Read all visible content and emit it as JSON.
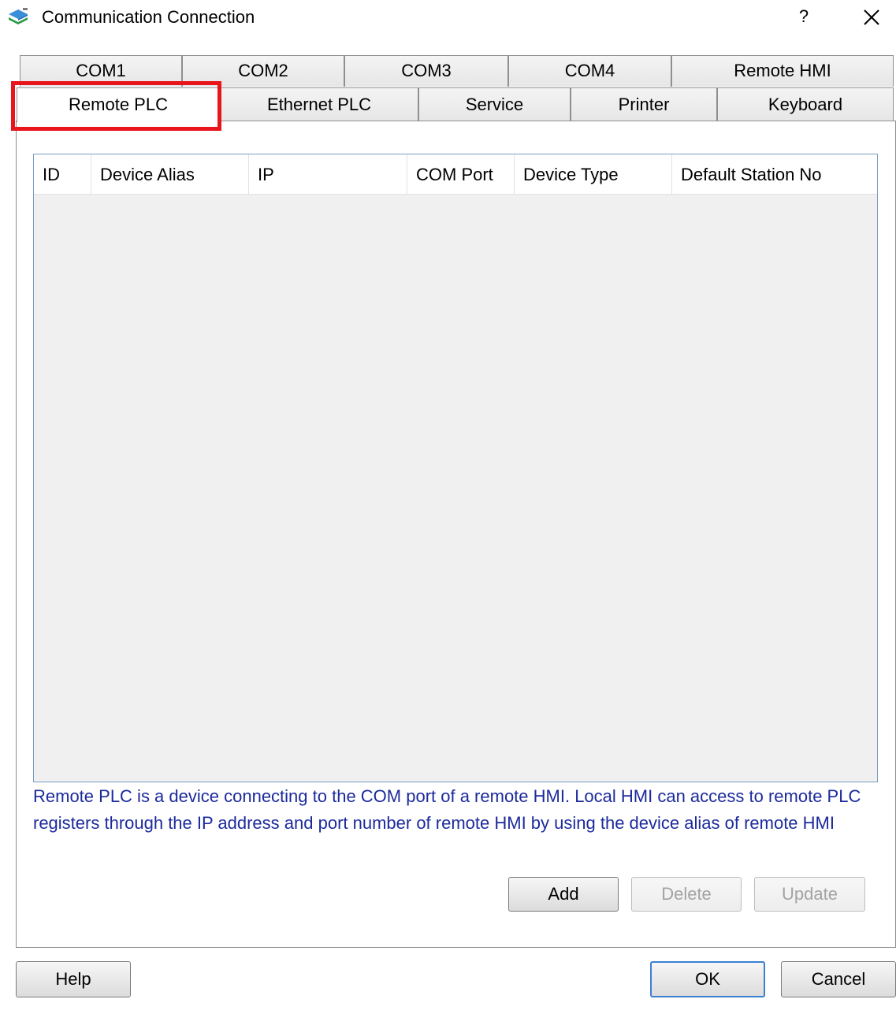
{
  "window": {
    "title": "Communication Connection",
    "help_label": "?",
    "icon": "app-layers-icon"
  },
  "tabs": {
    "row1": [
      "COM1",
      "COM2",
      "COM3",
      "COM4",
      "Remote HMI"
    ],
    "row2": [
      "Remote PLC",
      "Ethernet PLC",
      "Service",
      "Printer",
      "Keyboard"
    ],
    "active": "Remote PLC"
  },
  "table": {
    "columns": [
      "ID",
      "Device Alias",
      "IP",
      "COM Port",
      "Device Type",
      "Default Station No"
    ],
    "rows": []
  },
  "description": "Remote PLC is a device connecting to the COM port of a remote HMI. Local HMI can access to remote PLC registers through the IP address and port number of remote HMI by using the device alias of remote HMI",
  "buttons": {
    "add": "Add",
    "delete": "Delete",
    "update": "Update",
    "help": "Help",
    "ok": "OK",
    "cancel": "Cancel"
  },
  "colors": {
    "highlight": "#e8151d",
    "description_text": "#1c2a9c"
  }
}
